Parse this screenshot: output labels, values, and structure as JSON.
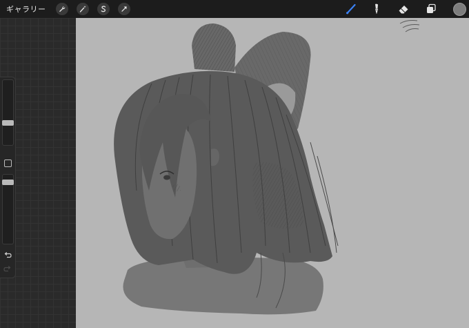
{
  "app": {
    "gallery_label": "ギャラリー"
  },
  "toolbar_left": {
    "icons": [
      "wrench-icon",
      "magic-wand-icon",
      "selection-s-icon",
      "transform-arrow-icon"
    ]
  },
  "toolbar_right": {
    "icons": [
      "brush-icon",
      "smudge-icon",
      "eraser-icon",
      "layers-icon"
    ],
    "active_tool": "brush",
    "active_color": "#3b82f6",
    "current_color": "#7d7d7d"
  },
  "sidebar": {
    "brush_size_level": 0.38,
    "opacity_level": 0.22
  },
  "colors": {
    "canvas_background": "#b6b6b6",
    "ui_dark": "#1c1c1c"
  }
}
